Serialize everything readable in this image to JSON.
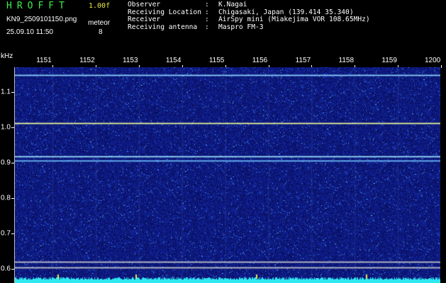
{
  "header": {
    "title": "HROFFT",
    "version": "1.00f",
    "filename": "KN9_2509101150.png",
    "datetime": "25.09.10 11:50",
    "meteor_label": "meteor",
    "meteor_count": "8",
    "info": [
      {
        "key": "Observer",
        "value": "K.Nagai"
      },
      {
        "key": "Receiving Location",
        "value": "Chigasaki, Japan (139.414 35.340)"
      },
      {
        "key": "Receiver",
        "value": "AirSpy mini (Miakejima VOR 108.65MHz)"
      },
      {
        "key": "Receiving antenna",
        "value": "Maspro FM-3"
      }
    ]
  },
  "axes": {
    "y_unit": "kHz",
    "x_ticks": [
      "1151",
      "1152",
      "1153",
      "1154",
      "1155",
      "1156",
      "1157",
      "1158",
      "1159",
      "1200"
    ],
    "y_ticks": [
      "1.1",
      "1.0",
      "0.9",
      "0.8",
      "0.7",
      "0.6"
    ],
    "y_range_khz": [
      0.56,
      1.17
    ]
  },
  "traces": [
    {
      "name": "",
      "freq_khz": 1.148,
      "color": "#8fd8ff"
    },
    {
      "name": "",
      "freq_khz": 1.012,
      "color": "#f0ff9a"
    },
    {
      "name": "",
      "freq_khz": 0.918,
      "color": "#9fe8ff"
    },
    {
      "name": "",
      "freq_khz": 0.905,
      "color": "#6fbfff"
    },
    {
      "name": "",
      "freq_khz": 0.62,
      "color": "#c8c8c8"
    },
    {
      "name": "",
      "freq_khz": 0.605,
      "color": "#c8c8c8"
    }
  ],
  "colors": {
    "background": "#000000",
    "noise_base": "#0a1070",
    "baseband": "#2ee8f0"
  }
}
